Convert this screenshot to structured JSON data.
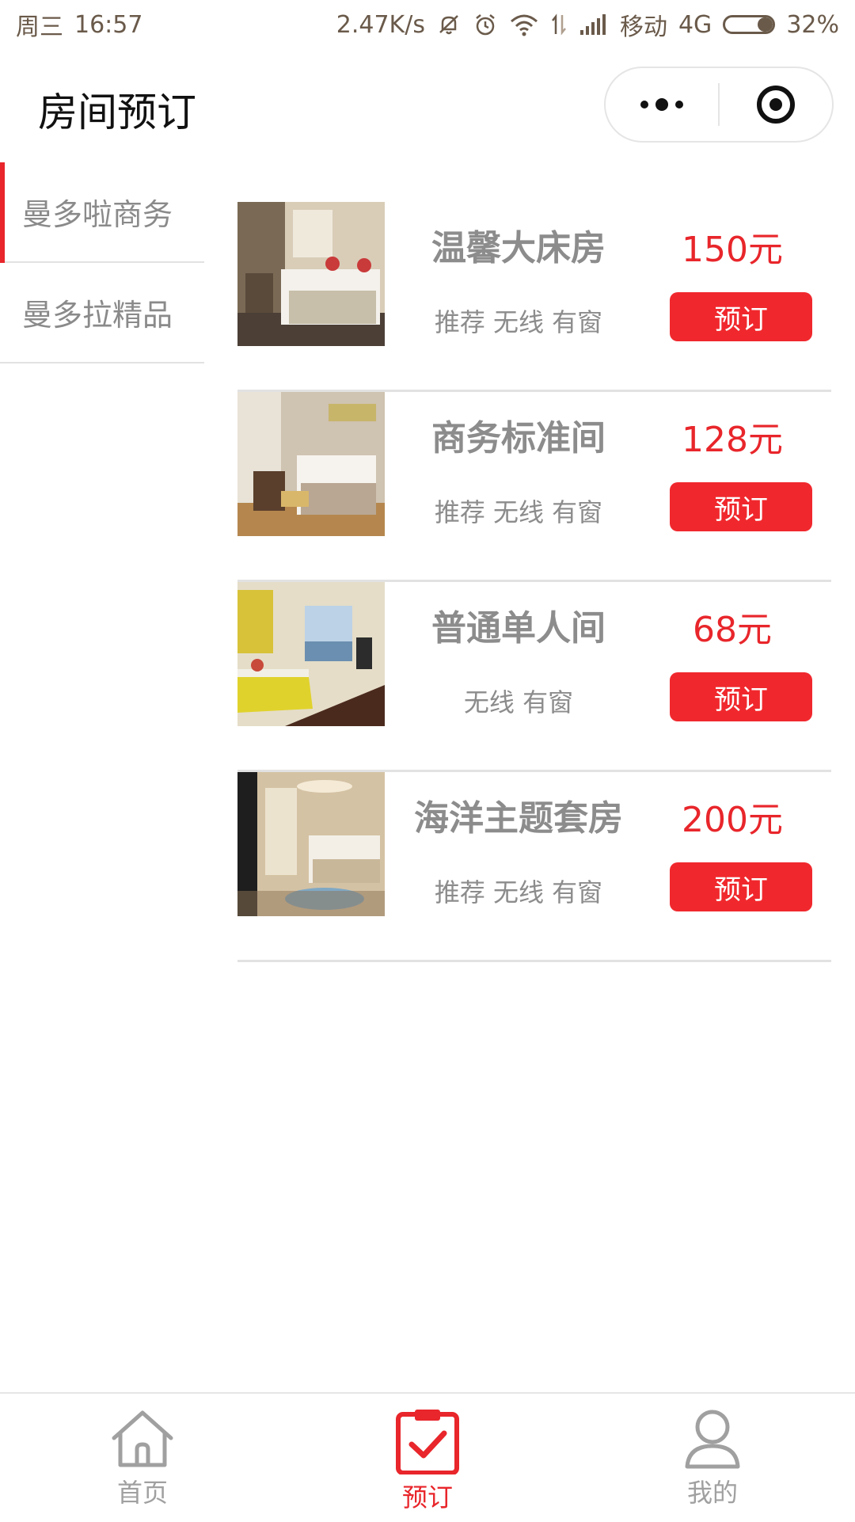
{
  "status_bar": {
    "day": "周三",
    "time": "16:57",
    "net_speed": "2.47K/s",
    "carrier": "移动",
    "network": "4G",
    "battery": "32%",
    "battery_level": 0.32
  },
  "nav": {
    "title": "房间预订"
  },
  "sidebar": {
    "items": [
      {
        "label": "曼多啦商务",
        "active": true
      },
      {
        "label": "曼多拉精品",
        "active": false
      }
    ]
  },
  "rooms": [
    {
      "name": "温馨大床房",
      "tags": "推荐 无线 有窗",
      "price": "150元",
      "button": "预订",
      "image": "bedroom-photo"
    },
    {
      "name": "商务标准间",
      "tags": "推荐 无线 有窗",
      "price": "128元",
      "button": "预订",
      "image": "twin-room-photo"
    },
    {
      "name": "普通单人间",
      "tags": "无线 有窗",
      "price": "68元",
      "button": "预订",
      "image": "single-room-photo"
    },
    {
      "name": "海洋主题套房",
      "tags": "推荐 无线 有窗",
      "price": "200元",
      "button": "预订",
      "image": "suite-photo"
    }
  ],
  "tabbar": {
    "items": [
      {
        "label": "首页",
        "icon": "home-icon",
        "active": false
      },
      {
        "label": "预订",
        "icon": "clipboard-check-icon",
        "active": true
      },
      {
        "label": "我的",
        "icon": "user-icon",
        "active": false
      }
    ]
  },
  "colors": {
    "accent": "#e8262b",
    "inactive": "#a0a0a0",
    "text_gray": "#8c8c8c"
  }
}
